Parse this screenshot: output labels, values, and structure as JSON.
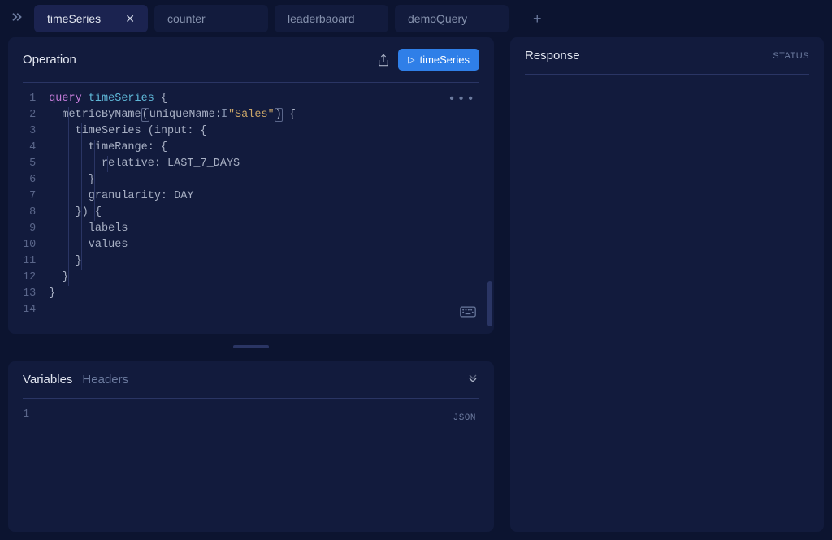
{
  "tabs": [
    {
      "label": "timeSeries",
      "active": true
    },
    {
      "label": "counter",
      "active": false
    },
    {
      "label": "leaderbaoard",
      "active": false
    },
    {
      "label": "demoQuery",
      "active": false
    }
  ],
  "operation": {
    "title": "Operation",
    "run_label": "timeSeries",
    "line_count": 14,
    "code": {
      "l1_kw": "query",
      "l1_name": "timeSeries",
      "l1_brace": " {",
      "l2_field": "metricByName",
      "l2_open": "(",
      "l2_arg": "uniqueName",
      "l2_colon": ": ",
      "l2_str": "\"Sales\"",
      "l2_close": ")",
      "l2_tail": " {",
      "l3": "    timeSeries (input: {",
      "l4": "      timeRange: {",
      "l5": "        relative: LAST_7_DAYS",
      "l6": "      }",
      "l7": "      granularity: DAY",
      "l8": "    }) {",
      "l9": "      labels",
      "l10": "      values",
      "l11": "    }",
      "l12": "  }",
      "l13": "}"
    }
  },
  "variables": {
    "tab_variables": "Variables",
    "tab_headers": "Headers",
    "json_hint": "JSON",
    "line_count": 1
  },
  "response": {
    "title": "Response",
    "status_label": "STATUS"
  }
}
